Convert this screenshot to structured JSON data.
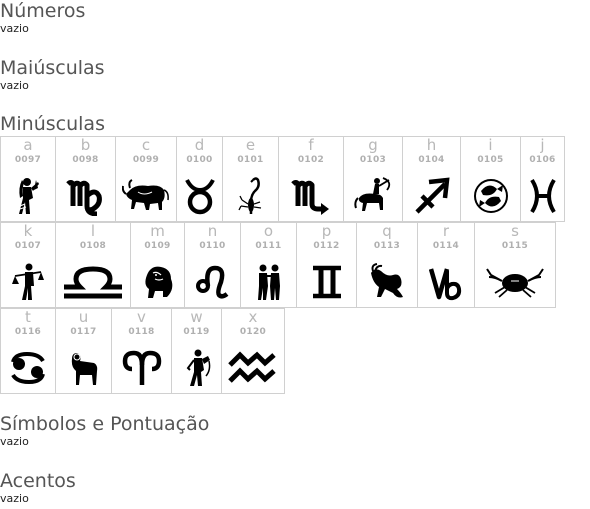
{
  "sections": {
    "numeros": {
      "title": "Números",
      "empty": "vazio"
    },
    "maiusculas": {
      "title": "Maiúsculas",
      "empty": "vazio"
    },
    "minusculas": {
      "title": "Minúsculas"
    },
    "simbolos": {
      "title": "Símbolos e Pontuação",
      "empty": "vazio"
    },
    "acentos": {
      "title": "Acentos",
      "empty": "vazio"
    }
  },
  "glyphs": [
    {
      "char": "a",
      "code": "0097",
      "icon": "virgo-maiden-icon"
    },
    {
      "char": "b",
      "code": "0098",
      "icon": "virgo-symbol-icon"
    },
    {
      "char": "c",
      "code": "0099",
      "icon": "taurus-bull-icon"
    },
    {
      "char": "d",
      "code": "0100",
      "icon": "taurus-symbol-icon"
    },
    {
      "char": "e",
      "code": "0101",
      "icon": "scorpio-scorpion-icon"
    },
    {
      "char": "f",
      "code": "0102",
      "icon": "scorpio-symbol-icon"
    },
    {
      "char": "g",
      "code": "0103",
      "icon": "sagittarius-archer-icon"
    },
    {
      "char": "h",
      "code": "0104",
      "icon": "sagittarius-symbol-icon"
    },
    {
      "char": "i",
      "code": "0105",
      "icon": "pisces-fish-icon"
    },
    {
      "char": "j",
      "code": "0106",
      "icon": "pisces-symbol-icon"
    },
    {
      "char": "k",
      "code": "0107",
      "icon": "libra-figure-icon"
    },
    {
      "char": "l",
      "code": "0108",
      "icon": "libra-symbol-icon"
    },
    {
      "char": "m",
      "code": "0109",
      "icon": "leo-lion-icon"
    },
    {
      "char": "n",
      "code": "0110",
      "icon": "leo-symbol-icon"
    },
    {
      "char": "o",
      "code": "0111",
      "icon": "gemini-twins-icon"
    },
    {
      "char": "p",
      "code": "0112",
      "icon": "gemini-symbol-icon"
    },
    {
      "char": "q",
      "code": "0113",
      "icon": "capricorn-goat-icon"
    },
    {
      "char": "r",
      "code": "0114",
      "icon": "capricorn-symbol-icon"
    },
    {
      "char": "s",
      "code": "0115",
      "icon": "cancer-crab-icon"
    },
    {
      "char": "t",
      "code": "0116",
      "icon": "cancer-symbol-icon"
    },
    {
      "char": "u",
      "code": "0117",
      "icon": "aries-ram-icon"
    },
    {
      "char": "v",
      "code": "0118",
      "icon": "aries-symbol-icon"
    },
    {
      "char": "w",
      "code": "0119",
      "icon": "aquarius-bearer-icon"
    },
    {
      "char": "x",
      "code": "0120",
      "icon": "aquarius-symbol-icon"
    }
  ]
}
